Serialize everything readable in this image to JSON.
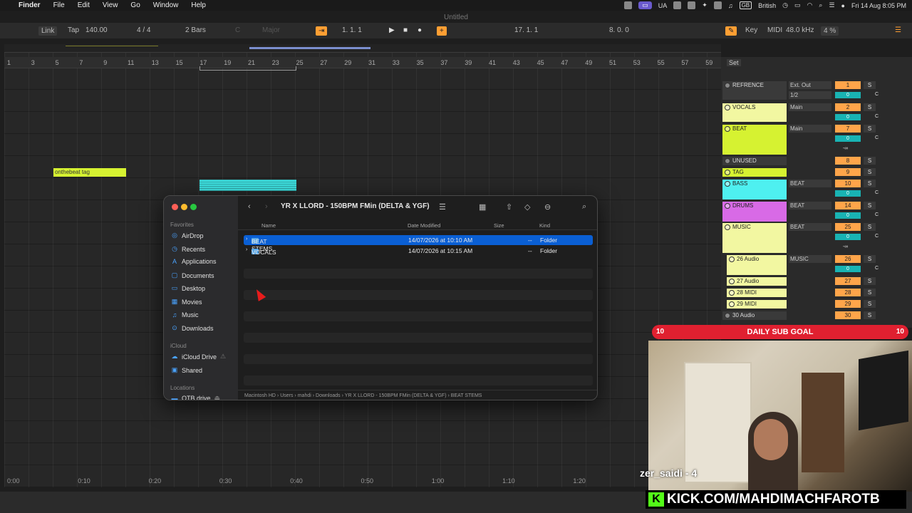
{
  "menubar": {
    "apple": "",
    "app_name": "Finder",
    "items": [
      "File",
      "Edit",
      "View",
      "Go",
      "Window",
      "Help"
    ],
    "status": {
      "ua": "UA",
      "lang": "British",
      "datetime": "Fri 14 Aug 8:05 PM",
      "gb": "GB"
    }
  },
  "window_title": "Untitled",
  "transport": {
    "link": "Link",
    "tap": "Tap",
    "tempo": "140.00",
    "sig": "4 / 4",
    "quant": "2 Bars",
    "key": "C",
    "scale": "Major",
    "pos": "1. 1. 1",
    "loop_start": "17. 1. 1",
    "loop_len": "8. 0. 0",
    "key_label": "Key",
    "midi_label": "MIDI",
    "sample_rate": "48.0 kHz",
    "cpu": "4 %"
  },
  "ruler": [
    "1",
    "3",
    "5",
    "7",
    "9",
    "11",
    "13",
    "15",
    "17",
    "19",
    "21",
    "23",
    "25",
    "27",
    "29",
    "31",
    "33",
    "35",
    "37",
    "39",
    "41",
    "43",
    "45",
    "47",
    "49",
    "51",
    "53",
    "55",
    "57",
    "59"
  ],
  "timeline": [
    "0:00",
    "0:10",
    "0:20",
    "0:30",
    "0:40",
    "0:50",
    "1:00",
    "1:10",
    "1:20"
  ],
  "clip_tag": "onthebeat tag",
  "mixer": {
    "set_label": "Set",
    "tracks": [
      {
        "name": "REFRENCE",
        "route": "Ext. Out",
        "route2": "1/2",
        "num": "1",
        "vol": "0"
      },
      {
        "name": "VOCALS",
        "route": "Main",
        "num": "2",
        "vol": "0"
      },
      {
        "name": "BEAT",
        "route": "Main",
        "num": "7",
        "vol": "0",
        "vol2": "-∞"
      },
      {
        "name": "UNUSED",
        "num": "8"
      },
      {
        "name": "TAG",
        "num": "9"
      },
      {
        "name": "BASS",
        "route": "BEAT",
        "num": "10",
        "vol": "0"
      },
      {
        "name": "DRUMS",
        "route": "BEAT",
        "num": "14",
        "vol": "0"
      },
      {
        "name": "MUSIC",
        "route": "BEAT",
        "num": "25",
        "vol": "0",
        "vol2": "-∞"
      },
      {
        "name": "26 Audio",
        "route": "MUSIC",
        "num": "26",
        "vol": "0"
      },
      {
        "name": "27 Audio",
        "num": "27"
      },
      {
        "name": "28 MIDI",
        "num": "28"
      },
      {
        "name": "29 MIDI",
        "num": "29"
      },
      {
        "name": "30 Audio",
        "num": "30"
      }
    ],
    "solo": "S",
    "c": "C"
  },
  "finder": {
    "title": "YR X LLORD - 150BPM FMin (DELTA & YGF)",
    "sidebar": {
      "favorites_label": "Favorites",
      "favorites": [
        "AirDrop",
        "Recents",
        "Applications",
        "Documents",
        "Desktop",
        "Movies",
        "Music",
        "Downloads"
      ],
      "icloud_label": "iCloud",
      "icloud": [
        "iCloud Drive",
        "Shared"
      ],
      "locations_label": "Locations",
      "locations": [
        "OTB drive"
      ]
    },
    "columns": {
      "name": "Name",
      "date": "Date Modified",
      "size": "Size",
      "kind": "Kind"
    },
    "rows": [
      {
        "name": "BEAT STEMS",
        "date": "14/07/2026 at 10:10 AM",
        "size": "--",
        "kind": "Folder"
      },
      {
        "name": "VOCALS",
        "date": "14/07/2026 at 10:15 AM",
        "size": "--",
        "kind": "Folder"
      }
    ],
    "path": [
      "Macintosh HD",
      "Users",
      "mahdi",
      "Downloads",
      "YR X LLORD - 150BPM FMin (DELTA & YGF)",
      "BEAT STEMS"
    ]
  },
  "overlay": {
    "sub_goal": "DAILY SUB GOAL",
    "sub_left": "10",
    "sub_right": "10",
    "username": "zer_saidi - 4",
    "kick": "KICK.COM/MAHDIMACHFAROTB",
    "kick_logo": "K"
  },
  "colors": {
    "refrence": "#3a3a3a",
    "vocals": "#f2f7a1",
    "beat": "#d6f231",
    "unused": "#3a3a3a",
    "tag": "#d6f231",
    "bass": "#4ef0f0",
    "drums": "#d86ae6",
    "music": "#f2f7a1",
    "sub": "#e02030",
    "kick": "#53fc18"
  }
}
